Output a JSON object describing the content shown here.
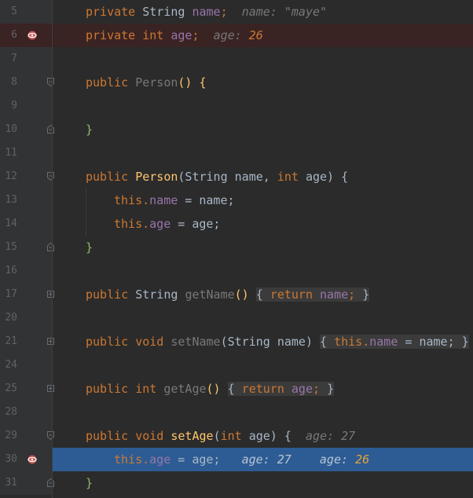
{
  "editor": {
    "lines": [
      {
        "num": "5",
        "t": {
          "a": "private ",
          "b": "String ",
          "c": "name",
          "d": ";",
          "h": "name: ",
          "hv": "\"maye\""
        }
      },
      {
        "num": "6",
        "t": {
          "a": "private ",
          "b": "int ",
          "c": "age",
          "d": ";",
          "h": "age: ",
          "hv": "26"
        }
      },
      {
        "num": "7"
      },
      {
        "num": "8",
        "t": {
          "a": "public ",
          "b": "Person",
          "c": "() {"
        }
      },
      {
        "num": "9"
      },
      {
        "num": "10",
        "t": {
          "a": "}"
        }
      },
      {
        "num": "11"
      },
      {
        "num": "12",
        "t": {
          "a": "public ",
          "b": "Person",
          "c": "(String name, ",
          "d": "int ",
          "e": "age) {"
        }
      },
      {
        "num": "13",
        "t": {
          "a": "this.",
          "b": "name",
          "c": " = name;"
        }
      },
      {
        "num": "14",
        "t": {
          "a": "this.",
          "b": "age",
          "c": " = age;"
        }
      },
      {
        "num": "15",
        "t": {
          "a": "}"
        }
      },
      {
        "num": "16"
      },
      {
        "num": "17",
        "t": {
          "a": "public ",
          "b": "String ",
          "c": "getName",
          "d": "() ",
          "e": "{ ",
          "f": "return ",
          "g": "name",
          "h": "; ",
          "i": "}"
        }
      },
      {
        "num": "20"
      },
      {
        "num": "21",
        "t": {
          "a": "public ",
          "b": "void ",
          "c": "setName",
          "d": "(String name) ",
          "e": "{ ",
          "f": "this.",
          "g": "name",
          "h": " = name; ",
          "i": "}"
        }
      },
      {
        "num": "24"
      },
      {
        "num": "25",
        "t": {
          "a": "public ",
          "b": "int ",
          "c": "getAge",
          "d": "() ",
          "e": "{ ",
          "f": "return ",
          "g": "age",
          "h": "; ",
          "i": "}"
        }
      },
      {
        "num": "28"
      },
      {
        "num": "29",
        "t": {
          "a": "public ",
          "b": "void ",
          "c": "setAge",
          "d": "(",
          "e": "int ",
          "f": "age) {",
          "h": "age: ",
          "hv": "27"
        }
      },
      {
        "num": "30",
        "t": {
          "a": "this.",
          "b": "age",
          "c": " = age;",
          "h1": "age: ",
          "hv1": "27",
          "h2": "age: ",
          "hv2": "26"
        }
      },
      {
        "num": "31",
        "t": {
          "a": "}"
        }
      }
    ]
  },
  "colors": {
    "background": "#2b2b2b",
    "gutter": "#313335",
    "keyword": "#cc7832",
    "method_decl": "#ffc66d",
    "field": "#9876aa",
    "execution_line": "#2d5c94",
    "breakpoint_line": "#3a2323"
  },
  "icons": {
    "breakpoint": "breakpoint-icon",
    "fold": "fold-icon"
  }
}
